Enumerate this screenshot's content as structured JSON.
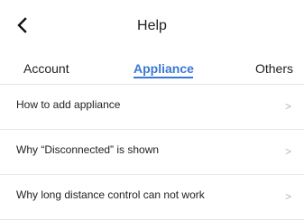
{
  "header": {
    "title": "Help",
    "back_icon": "chevron-left-icon"
  },
  "tabs": [
    {
      "label": "Account",
      "active": false
    },
    {
      "label": "Appliance",
      "active": true
    },
    {
      "label": "Others",
      "active": false
    }
  ],
  "accent_color": "#3a78d6",
  "items": [
    {
      "label": "How to add appliance",
      "chevron": ">"
    },
    {
      "label": "Why “Disconnected” is shown",
      "chevron": ">"
    },
    {
      "label": "Why long distance control can not work",
      "chevron": ">"
    }
  ]
}
